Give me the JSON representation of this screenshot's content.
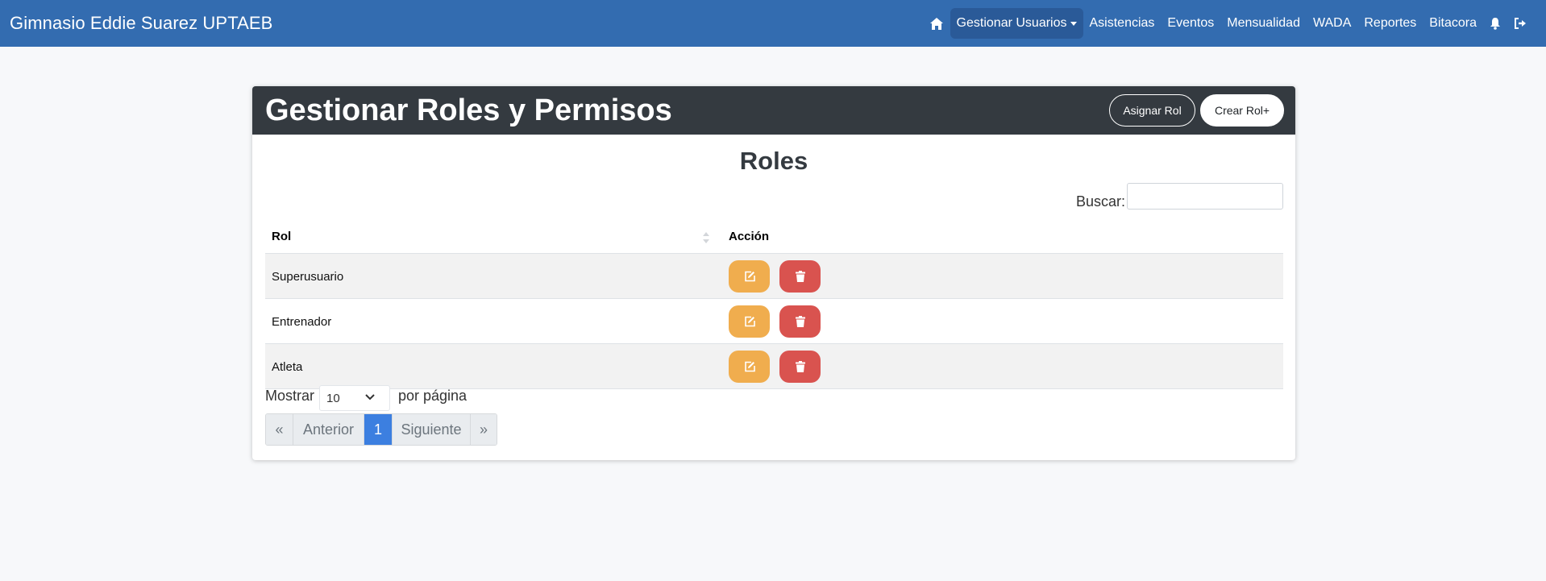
{
  "navbar": {
    "brand": "Gimnasio Eddie Suarez UPTAEB",
    "items": [
      {
        "label": "Gestionar Usuarios"
      },
      {
        "label": "Asistencias"
      },
      {
        "label": "Eventos"
      },
      {
        "label": "Mensualidad"
      },
      {
        "label": "WADA"
      },
      {
        "label": "Reportes"
      },
      {
        "label": "Bitacora"
      }
    ],
    "icons": [
      "home-icon",
      "bell-icon",
      "logout-icon"
    ]
  },
  "card": {
    "title": "Gestionar Roles y Permisos",
    "assign_label": "Asignar Rol",
    "create_label": "Crear Rol+"
  },
  "roles": {
    "heading": "Roles",
    "search_label": "Buscar:",
    "search_value": "",
    "columns": [
      "Rol",
      "Acción"
    ],
    "rows": [
      {
        "rol": "Superusuario"
      },
      {
        "rol": "Entrenador"
      },
      {
        "rol": "Atleta"
      }
    ],
    "show_label": "Mostrar",
    "per_page_value": "10",
    "per_page_label": "por página",
    "pagination": {
      "first": "«",
      "prev": "Anterior",
      "current": "1",
      "next": "Siguiente",
      "last": "»"
    }
  },
  "colors": {
    "navbar": "#336cb0",
    "card_header": "#343a40",
    "edit": "#f0ad4e",
    "delete": "#d9534f",
    "page_active": "#3c7fe0"
  }
}
